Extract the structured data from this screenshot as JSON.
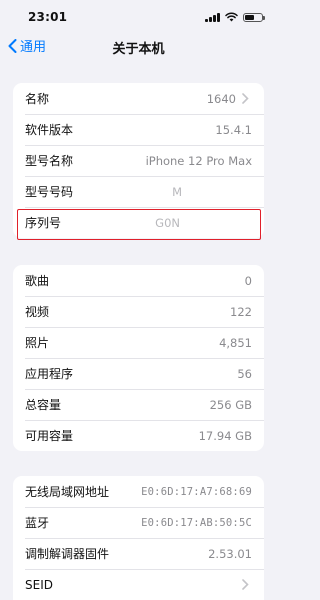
{
  "status_bar": {
    "time": "23:01"
  },
  "nav": {
    "back_label": "通用",
    "title": "关于本机"
  },
  "group1": [
    {
      "label": "名称",
      "value": "1640",
      "chevron": true
    },
    {
      "label": "软件版本",
      "value": "15.4.1",
      "chevron": false
    },
    {
      "label": "型号名称",
      "value": "iPhone 12 Pro Max",
      "chevron": false
    },
    {
      "label": "型号号码",
      "value": "M",
      "chevron": false
    },
    {
      "label": "序列号",
      "value": "G0N",
      "chevron": false
    }
  ],
  "group2": [
    {
      "label": "歌曲",
      "value": "0"
    },
    {
      "label": "视频",
      "value": "122"
    },
    {
      "label": "照片",
      "value": "4,851"
    },
    {
      "label": "应用程序",
      "value": "56"
    },
    {
      "label": "总容量",
      "value": "256 GB"
    },
    {
      "label": "可用容量",
      "value": "17.94 GB"
    }
  ],
  "group3": [
    {
      "label": "无线局域网地址",
      "value": "E0:6D:17:A7:68:69",
      "chevron": false
    },
    {
      "label": "蓝牙",
      "value": "E0:6D:17:AB:50:5C",
      "chevron": false
    },
    {
      "label": "调制解调器固件",
      "value": "2.53.01",
      "chevron": false
    },
    {
      "label": "SEID",
      "value": "",
      "chevron": true
    }
  ],
  "colors": {
    "accent": "#007aff",
    "highlight_border": "#e0202b",
    "background": "#f2f2f7"
  }
}
